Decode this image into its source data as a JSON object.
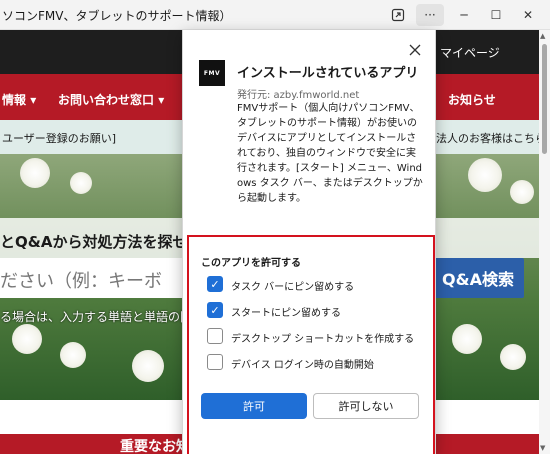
{
  "window": {
    "title": "ソコンFMV、タブレットのサポート情報）",
    "controls": {
      "open_in_app_icon": "open-in-app-icon",
      "more_label": "···",
      "minimize_label": "─",
      "maximize_label": "☐",
      "close_label": "✕"
    }
  },
  "page": {
    "header_link": "マイページ",
    "nav_items": [
      "情報",
      "お問い合わせ窓口",
      "お知らせ"
    ],
    "notice_left": "ユーザー登録のお願い]",
    "notice_right": "法人のお客様はこちら",
    "hero_title": "とQ&Aから対処方法を探せ",
    "search_placeholder": "ださい（例：キーボ",
    "search_button": "Q&A検索",
    "hero_note": "る場合は、入力する単語と単語の間",
    "important_notice": "重要なお知らせ"
  },
  "dialog": {
    "logo_text": "FMV",
    "title": "インストールされているアプリ",
    "publisher": "発行元: azby.fmworld.net",
    "description": "FMVサポート（個人向けパソコンFMV、タブレットのサポート情報）がお使いのデバイスにアプリとしてインストールされており、独自のウィンドウで安全に実行されます。[スタート] メニュー、Windows タスク バー、またはデスクトップから起動します。",
    "permission_title": "このアプリを許可する",
    "options": [
      {
        "label": "タスク バーにピン留めする",
        "checked": true
      },
      {
        "label": "スタートにピン留めする",
        "checked": true
      },
      {
        "label": "デスクトップ ショートカットを作成する",
        "checked": false
      },
      {
        "label": "デバイス ログイン時の自動開始",
        "checked": false
      }
    ],
    "allow_button": "許可",
    "deny_button": "許可しない"
  },
  "colors": {
    "accent": "#1f6fd6",
    "brand_red": "#b51a26",
    "highlight_border": "#d4121e"
  }
}
